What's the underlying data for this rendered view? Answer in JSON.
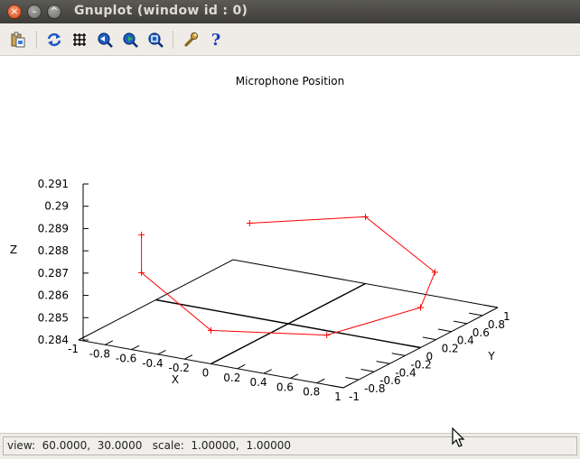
{
  "window": {
    "title": "Gnuplot (window id : 0)"
  },
  "toolbar": {
    "buttons": [
      {
        "name": "copy-to-clipboard",
        "icon": "clipboard-icon"
      },
      {
        "name": "replot",
        "icon": "refresh-icon"
      },
      {
        "name": "toggle-grid",
        "icon": "grid-icon"
      },
      {
        "name": "previous-zoom",
        "icon": "zoom-previous-icon"
      },
      {
        "name": "next-zoom",
        "icon": "zoom-next-icon"
      },
      {
        "name": "autoscale",
        "icon": "zoom-autoscale-icon"
      },
      {
        "name": "settings",
        "icon": "wrench-icon"
      },
      {
        "name": "help",
        "icon": "help-icon"
      }
    ]
  },
  "status": {
    "text": "view:  60.0000,  30.0000   scale:  1.00000,  1.00000"
  },
  "colors": {
    "series": "#ff0000",
    "axes": "#000000",
    "titlebar": "#4a4945",
    "toolbar": "#efebe7"
  },
  "chart_data": {
    "type": "line",
    "title": "Microphone Position",
    "xlabel": "X",
    "ylabel": "Y",
    "zlabel": "Z",
    "xlim": [
      -1,
      1
    ],
    "ylim": [
      -1,
      1
    ],
    "zlim": [
      0.284,
      0.291
    ],
    "view": [
      60,
      30
    ],
    "x_ticks": [
      "-1",
      "-0.8",
      "-0.6",
      "-0.4",
      "-0.2",
      "0",
      "0.2",
      "0.4",
      "0.6",
      "0.8",
      "1"
    ],
    "y_ticks": [
      "-1",
      "-0.8",
      "-0.6",
      "-0.4",
      "-0.2",
      "0",
      "0.2",
      "0.4",
      "0.6",
      "0.8",
      "1"
    ],
    "z_ticks": [
      "0.284",
      "0.285",
      "0.286",
      "0.287",
      "0.288",
      "0.289",
      "0.29",
      "0.291"
    ],
    "grid": false,
    "legend": "none",
    "series": [
      {
        "points": [
          {
            "x": -0.7,
            "y": -0.7,
            "z": 0.2885
          },
          {
            "x": -0.7,
            "y": -0.7,
            "z": 0.2868
          },
          {
            "x": 0.0,
            "y": -1.0,
            "z": 0.2855
          },
          {
            "x": 0.7,
            "y": -0.7,
            "z": 0.2855
          },
          {
            "x": 1.0,
            "y": 0.0,
            "z": 0.2858
          },
          {
            "x": 0.7,
            "y": 0.7,
            "z": 0.2858
          },
          {
            "x": 0.0,
            "y": 1.0,
            "z": 0.287
          },
          {
            "x": -0.7,
            "y": 0.7,
            "z": 0.2865
          }
        ]
      }
    ]
  }
}
